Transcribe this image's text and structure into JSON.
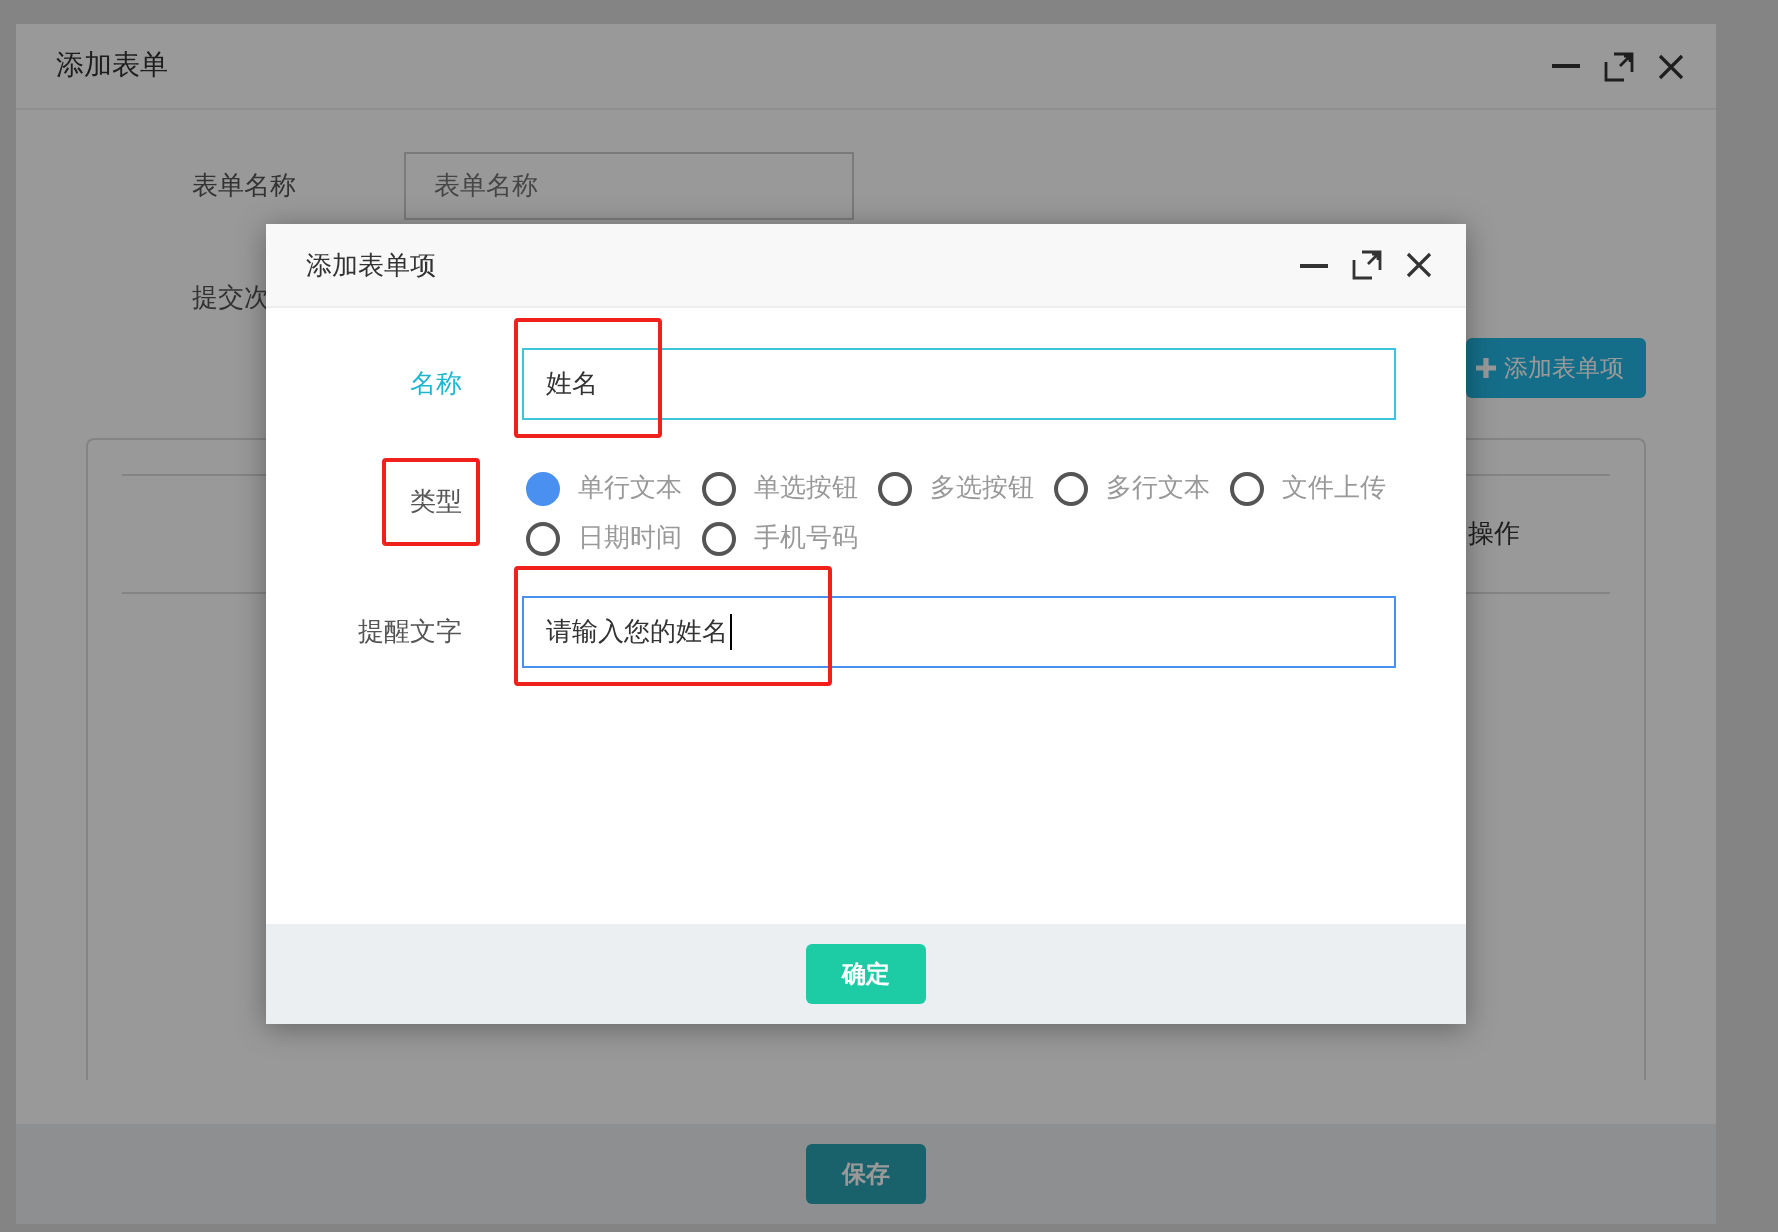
{
  "outer_dialog": {
    "title": "添加表单",
    "form": [
      {
        "label": "表单名称",
        "placeholder": "表单名称"
      },
      {
        "label": "提交次"
      }
    ],
    "add_item_button": "添加表单项",
    "table": {
      "columns": [
        "操作"
      ]
    },
    "save_button": "保存"
  },
  "dialog": {
    "title": "添加表单项",
    "fields": [
      {
        "kind": "text",
        "label": "名称",
        "value": "姓名",
        "valid": true,
        "focused": false,
        "highlighted": true
      },
      {
        "kind": "radio",
        "label": "类型",
        "highlighted": true,
        "options": [
          {
            "label": "单行文本",
            "selected": true
          },
          {
            "label": "单选按钮",
            "selected": false
          },
          {
            "label": "多选按钮",
            "selected": false
          },
          {
            "label": "多行文本",
            "selected": false
          },
          {
            "label": "文件上传",
            "selected": false
          },
          {
            "label": "日期时间",
            "selected": false
          },
          {
            "label": "手机号码",
            "selected": false
          }
        ]
      },
      {
        "kind": "text",
        "label": "提醒文字",
        "value": "请输入您的姓名",
        "valid": false,
        "focused": true,
        "highlighted": true
      }
    ],
    "confirm_button": "确定"
  }
}
